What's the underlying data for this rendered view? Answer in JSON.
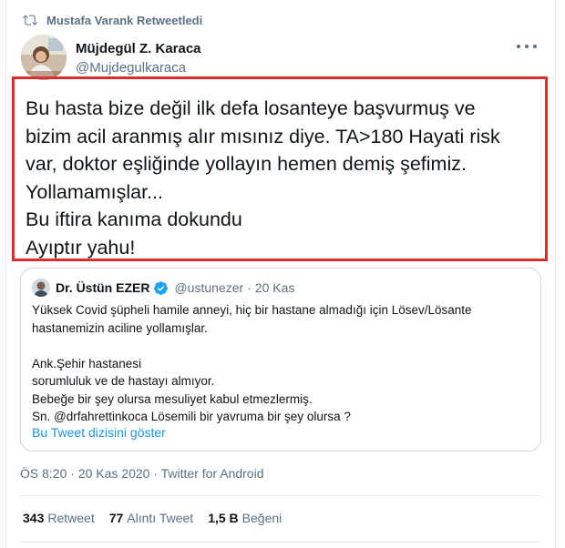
{
  "retweet_header": {
    "text": "Mustafa Varank Retweetledi",
    "icon": "retweet-icon"
  },
  "author": {
    "name": "Müjdegül Z. Karaca",
    "handle": "@Mujdegulkaraca"
  },
  "tweet": {
    "text": "Bu hasta bize değil ilk defa losanteye başvurmuş ve\nbizim acil aranmış alır mısınız diye. TA>180 Hayati risk\nvar, doktor eşliğinde yollayın hemen demiş şefimiz.\nYollamamışlar...\nBu iftira kanıma dokundu\nAyıptır yahu!"
  },
  "quoted_tweet": {
    "name": "Dr. Üstün EZER",
    "handle": "@ustunezer",
    "separator": "·",
    "date": "20 Kas",
    "text": "Yüksek Covid şüpheli hamile anneyi, hiç bir hastane almadığı için Lösev/Lösante\nhastanemizin aciline yollamışlar.\n\nAnk.Şehir hastanesi\nsorumluluk ve de hastayı almıyor.\nBebeğe bir şey olursa mesuliyet kabul etmezlermiş.\nSn. @drfahrettinkoca Lösemili bir yavruma bir şey olursa ?",
    "show_thread": "Bu Tweet dizisini göster"
  },
  "meta": {
    "time": "ÖS 8:20",
    "sep": "·",
    "date": "20 Kas 2020",
    "source": "Twitter for Android"
  },
  "stats": {
    "retweets": {
      "count": "343",
      "label": "Retweet"
    },
    "quotes": {
      "count": "77",
      "label": "Alıntı Tweet"
    },
    "likes": {
      "count": "1,5 B",
      "label": "Beğeni"
    }
  },
  "colors": {
    "accent": "#1b95e0",
    "highlight_border": "#d92e2a",
    "secondary_text": "#5b7083",
    "verified": "#1da1f2"
  }
}
